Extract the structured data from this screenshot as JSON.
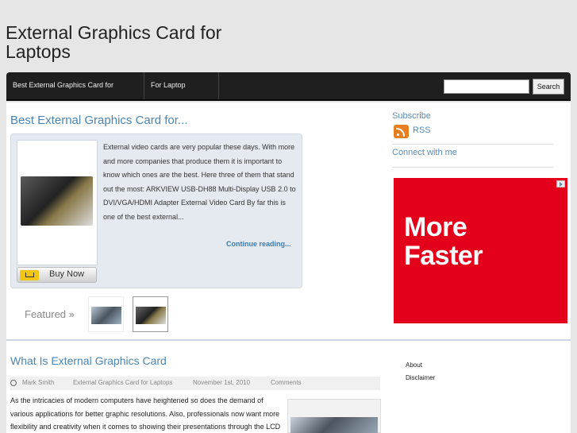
{
  "site": {
    "title": "External Graphics Card for Laptops"
  },
  "nav": {
    "items": [
      {
        "label": "Best External Graphics Card for Laptops"
      },
      {
        "label": "For Laptop Gaming"
      }
    ],
    "search": {
      "value": "",
      "button_label": "Search"
    }
  },
  "post1": {
    "title": "Best External Graphics Card for...",
    "excerpt": "External video cards are very popular these days. With more and more companies that produce them it is important to know which ones are the best. Here three of them that stand out the most: ARKVIEW USB-DH88 Multi-Display USB 2.0 to DVI/VGA/HDMI Adapter External Video Card By far this is one of the best external...",
    "continue_label": "Continue reading...",
    "buy_label": "Buy Now"
  },
  "featured": {
    "label": "Featured »"
  },
  "sidebar": {
    "subscribe_label": "Subscribe",
    "rss_label": "RSS",
    "connect_label": "Connect with me",
    "ad_text": "More\nFaster",
    "ad_color": "#e2001a",
    "links": [
      "About",
      "Disclaimer"
    ]
  },
  "post2": {
    "title": "What Is External Graphics Card",
    "author": "Mark Smith",
    "category": "External Graphics Card for Laptops",
    "date": "November 1st, 2010",
    "comments": "Comments",
    "text": "As the intricacies of modern computers have heightened so does the demand of various applications for better graphic resolutions. Also, professionals now want more flexibility and creativity when it comes to showing their presentations through the LCD"
  },
  "colors": {
    "accent": "#4a86b5",
    "nav_bg": "#1f1f1f",
    "page_bg": "#e6e6e6"
  }
}
